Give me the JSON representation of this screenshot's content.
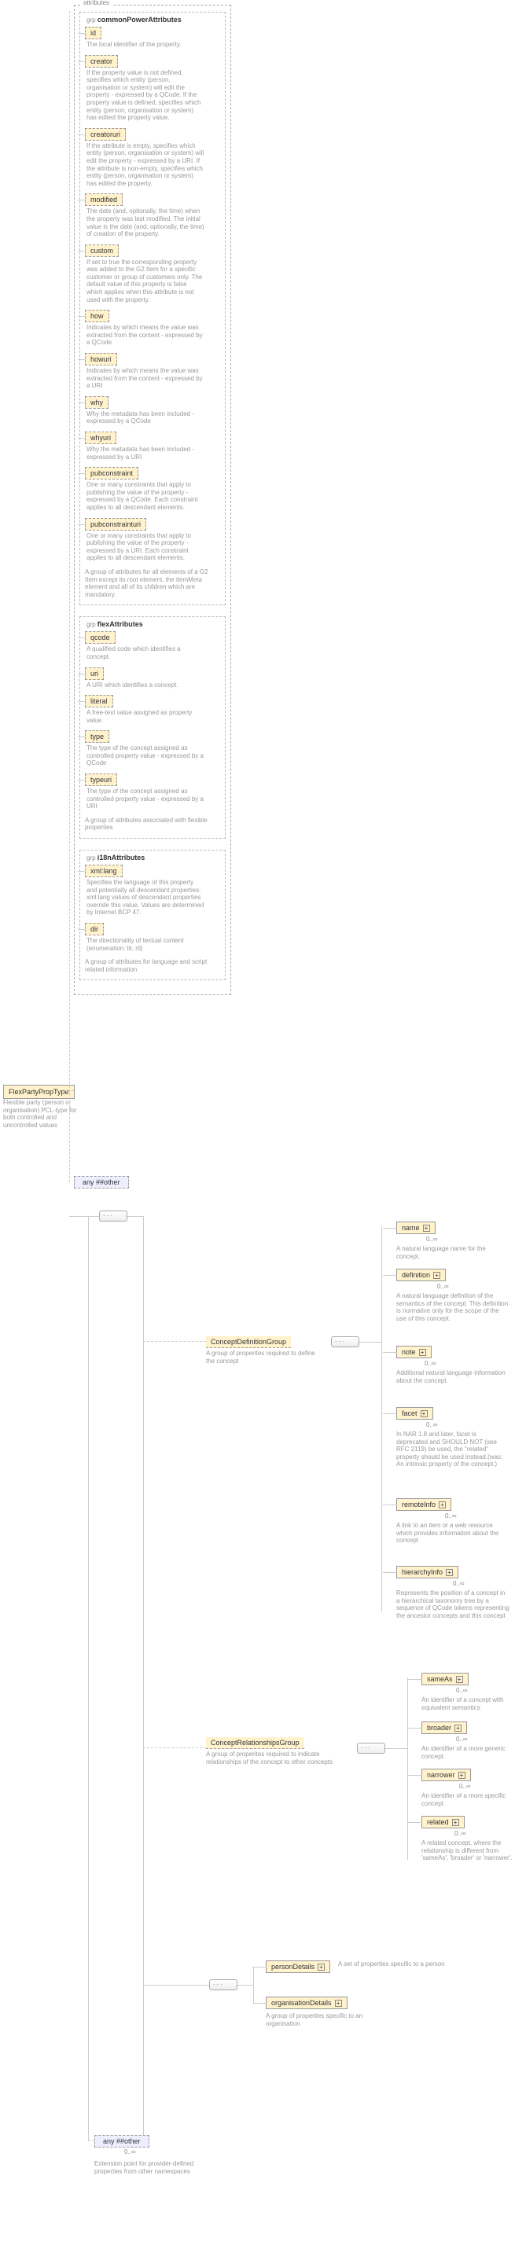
{
  "root": {
    "name": "FlexPartyPropType",
    "desc": "Flexible party (person or organisation) PCL-type for both controlled and uncontrolled values"
  },
  "attributes_tab": "attributes",
  "groups": {
    "common": {
      "label_prefix": "grp",
      "title": "commonPowerAttributes",
      "attrs": [
        {
          "name": "id",
          "desc": "The local identifier of the property."
        },
        {
          "name": "creator",
          "desc": "If the property value is not defined, specifies which entity (person, organisation or system) will edit the property - expressed by a QCode. If the property value is defined, specifies which entity (person, organisation or system) has edited the property value."
        },
        {
          "name": "creatoruri",
          "desc": "If the attribute is empty, specifies which entity (person, organisation or system) will edit the property - expressed by a URI. If the attribute is non-empty, specifies which entity (person, organisation or system) has edited the property."
        },
        {
          "name": "modified",
          "desc": "The date (and, optionally, the time) when the property was last modified. The initial value is the date (and, optionally, the time) of creation of the property."
        },
        {
          "name": "custom",
          "desc": "If set to true the corresponding property was added to the G2 Item for a specific customer or group of customers only. The default value of this property is false which applies when this attribute is not used with the property."
        },
        {
          "name": "how",
          "desc": "Indicates by which means the value was extracted from the content - expressed by a QCode"
        },
        {
          "name": "howuri",
          "desc": "Indicates by which means the value was extracted from the content - expressed by a URI"
        },
        {
          "name": "why",
          "desc": "Why the metadata has been included - expressed by a QCode"
        },
        {
          "name": "whyuri",
          "desc": "Why the metadata has been included - expressed by a URI"
        },
        {
          "name": "pubconstraint",
          "desc": "One or many constraints that apply to publishing the value of the property - expressed by a QCode. Each constraint applies to all descendant elements."
        },
        {
          "name": "pubconstrainturi",
          "desc": "One or many constraints that apply to publishing the value of the property - expressed by a URI. Each constraint applies to all descendant elements."
        }
      ],
      "group_desc": "A group of attributes for all elements of a G2 Item except its root element, the itemMeta element and all of its children which are mandatory."
    },
    "flex": {
      "label_prefix": "grp",
      "title": "flexAttributes",
      "attrs": [
        {
          "name": "qcode",
          "desc": "A qualified code which identifies a concept."
        },
        {
          "name": "uri",
          "desc": "A URI which identifies a concept."
        },
        {
          "name": "literal",
          "desc": "A free-text value assigned as property value."
        },
        {
          "name": "type",
          "desc": "The type of the concept assigned as controlled property value - expressed by a QCode"
        },
        {
          "name": "typeuri",
          "desc": "The type of the concept assigned as controlled property value - expressed by a URI"
        }
      ],
      "group_desc": "A group of attributes associated with flexible properties"
    },
    "i18n": {
      "label_prefix": "grp",
      "title": "i18nAttributes",
      "attrs": [
        {
          "name": "xml:lang",
          "desc": "Specifies the language of this property and potentially all descendant properties. xml:lang values of descendant properties override this value. Values are determined by Internet BCP 47."
        },
        {
          "name": "dir",
          "desc": "The directionality of textual content (enumeration: ltr, rtl)"
        }
      ],
      "group_desc": "A group of attributes for language and script related information"
    }
  },
  "any_other": "any ##other",
  "cdg": {
    "title": "ConceptDefinitionGroup",
    "desc": "A group of properites required to define the concept",
    "children": [
      {
        "name": "name",
        "desc": "A natural language name for the concept."
      },
      {
        "name": "definition",
        "desc": "A natural language definition of the semantics of the concept. This definition is normative only for the scope of the use of this concept."
      },
      {
        "name": "note",
        "desc": "Additional natural language information about the concept."
      },
      {
        "name": "facet",
        "desc": "In NAR 1.8 and later, facet is deprecated and SHOULD NOT (see RFC 2119) be used, the \"related\" property should be used instead.(was: An intrinsic property of the concept.)"
      },
      {
        "name": "remoteInfo",
        "desc": "A link to an item or a web resource which provides information about the concept"
      },
      {
        "name": "hierarchyInfo",
        "desc": "Represents the position of a concept in a hierarchical taxonomy tree by a sequence of QCode tokens representing the ancestor concepts and this concept"
      }
    ],
    "occ": "0..∞"
  },
  "crg": {
    "title": "ConceptRelationshipsGroup",
    "desc": "A group of properites required to indicate relationships of the concept to other concepts",
    "children": [
      {
        "name": "sameAs",
        "desc": "An identifier of a concept with equivalent semantics"
      },
      {
        "name": "broader",
        "desc": "An identifier of a more generic concept."
      },
      {
        "name": "narrower",
        "desc": "An identifier of a more specific concept."
      },
      {
        "name": "related",
        "desc": "A related concept, where the relationship is different from 'sameAs', 'broader' or 'narrower'."
      }
    ],
    "occ": "0..∞"
  },
  "lower_choice": [
    {
      "name": "personDetails",
      "desc": "A set of properties specific to a person"
    },
    {
      "name": "organisationDetails",
      "desc": "A group of properties specific to an organisation"
    }
  ],
  "extension": {
    "label": "any ##other",
    "occ": "0..∞",
    "desc": "Extension point for provider-defined properties from other namespaces"
  }
}
